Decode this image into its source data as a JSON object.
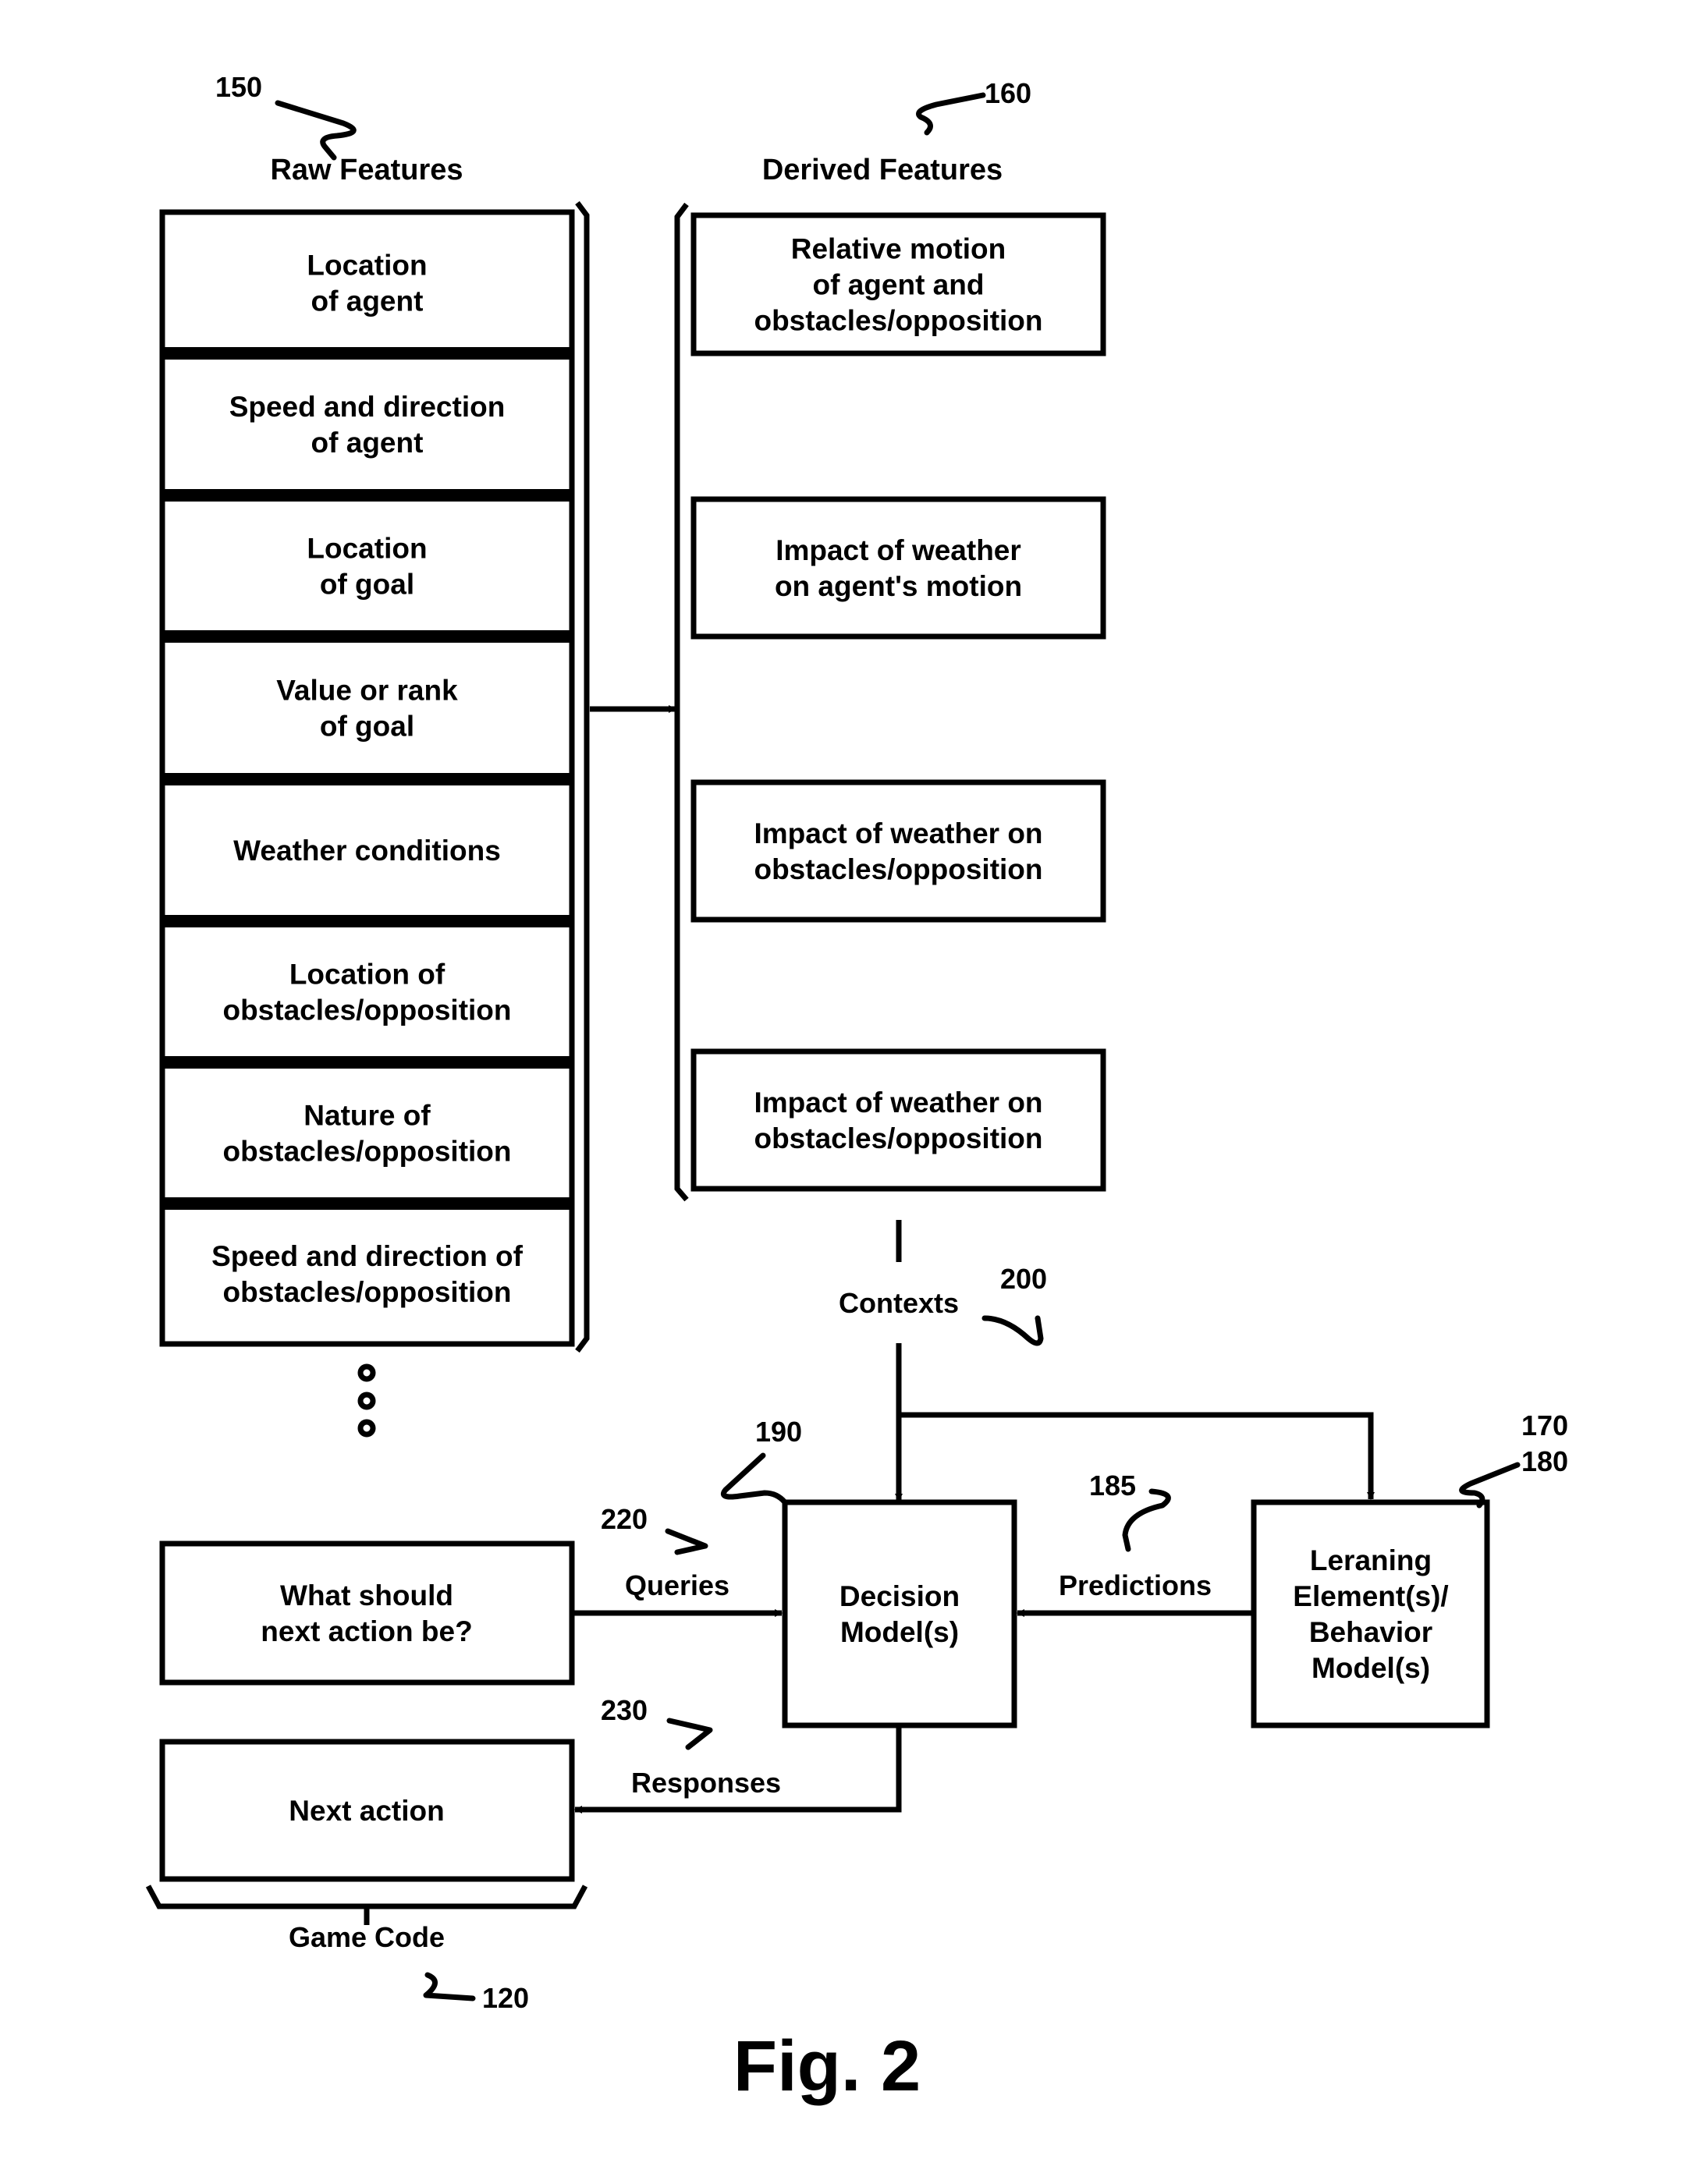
{
  "figure": {
    "title": "Fig. 2",
    "raw_features": {
      "ref": "150",
      "heading": "Raw Features",
      "items": [
        [
          "Location",
          "of agent"
        ],
        [
          "Speed and direction",
          "of agent"
        ],
        [
          "Location",
          "of goal"
        ],
        [
          "Value or rank",
          "of goal"
        ],
        [
          "Weather conditions"
        ],
        [
          "Location of",
          "obstacles/opposition"
        ],
        [
          "Nature of",
          "obstacles/opposition"
        ],
        [
          "Speed and direction of",
          "obstacles/opposition"
        ]
      ],
      "continuation": "ellipsis-dots"
    },
    "derived_features": {
      "ref": "160",
      "heading": "Derived Features",
      "items": [
        [
          "Relative motion",
          "of agent and",
          "obstacles/opposition"
        ],
        [
          "Impact of weather",
          "on agent's motion"
        ],
        [
          "Impact of weather on",
          "obstacles/opposition"
        ],
        [
          "Impact of weather on",
          "obstacles/opposition"
        ]
      ]
    },
    "contexts": {
      "label": "Contexts",
      "ref": "200"
    },
    "decision_model": {
      "ref": "190",
      "lines": [
        "Decision",
        "Model(s)"
      ]
    },
    "learning_model": {
      "refs": [
        "170",
        "180"
      ],
      "lines": [
        "Leraning",
        "Element(s)/",
        "Behavior",
        "Model(s)"
      ]
    },
    "predictions": {
      "label": "Predictions",
      "ref": "185"
    },
    "queries": {
      "label": "Queries",
      "ref": "220"
    },
    "responses": {
      "label": "Responses",
      "ref": "230"
    },
    "query_box": {
      "lines": [
        "What should",
        "next action be?"
      ]
    },
    "action_box": {
      "lines": [
        "Next action"
      ]
    },
    "game_code": {
      "label": "Game Code",
      "ref": "120"
    }
  }
}
